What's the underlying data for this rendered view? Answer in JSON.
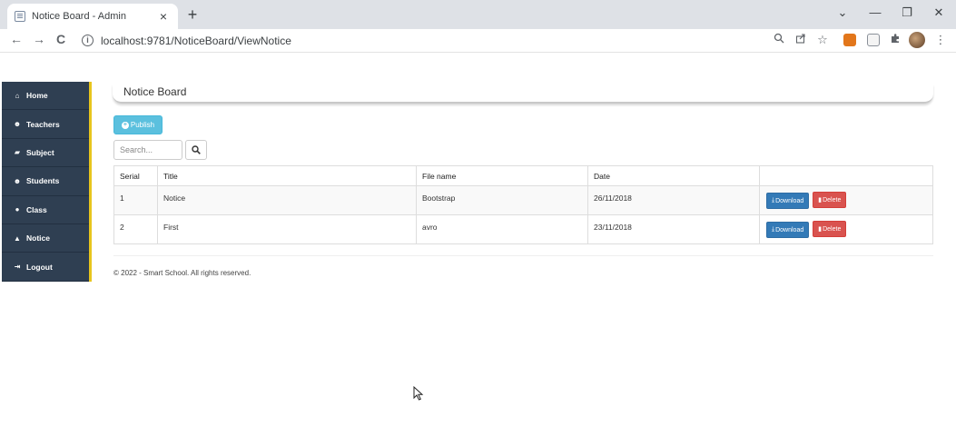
{
  "browser": {
    "tab_title": "Notice Board - Admin",
    "tab_close": "×",
    "new_tab": "+",
    "url": "localhost:9781/NoticeBoard/ViewNotice",
    "controls": {
      "minimize": "—",
      "restore": "❐",
      "close": "✕",
      "chevron": "⌄"
    },
    "nav": {
      "back": "←",
      "forward": "→",
      "reload": "C"
    }
  },
  "sidebar": {
    "items": [
      {
        "label": "Home",
        "icon": "home-icon",
        "glyph": "⌂"
      },
      {
        "label": "Teachers",
        "icon": "users-icon",
        "glyph": "☻"
      },
      {
        "label": "Subject",
        "icon": "book-icon",
        "glyph": "▰"
      },
      {
        "label": "Students",
        "icon": "users-icon",
        "glyph": "☻"
      },
      {
        "label": "Class",
        "icon": "circle-icon",
        "glyph": "●"
      },
      {
        "label": "Notice",
        "icon": "bell-icon",
        "glyph": "▲"
      },
      {
        "label": "Logout",
        "icon": "logout-icon",
        "glyph": "⇥"
      }
    ]
  },
  "main": {
    "title": "Notice Board",
    "publish_label": "Publish",
    "search_placeholder": "Search...",
    "table": {
      "headers": [
        "Serial",
        "Title",
        "File name",
        "Date",
        ""
      ],
      "rows": [
        {
          "serial": "1",
          "title": "Notice",
          "file": "Bootstrap",
          "date": "26/11/2018"
        },
        {
          "serial": "2",
          "title": "First",
          "file": "avro",
          "date": "23/11/2018"
        }
      ],
      "download_label": "Download",
      "delete_label": "Delete"
    },
    "footer": "© 2022 - Smart School. All rights reserved."
  },
  "colors": {
    "sidebar_bg": "#2f3f52",
    "sidebar_accent": "#e8c51d",
    "publish": "#5bc0de",
    "download": "#337ab7",
    "delete": "#d9534f"
  }
}
